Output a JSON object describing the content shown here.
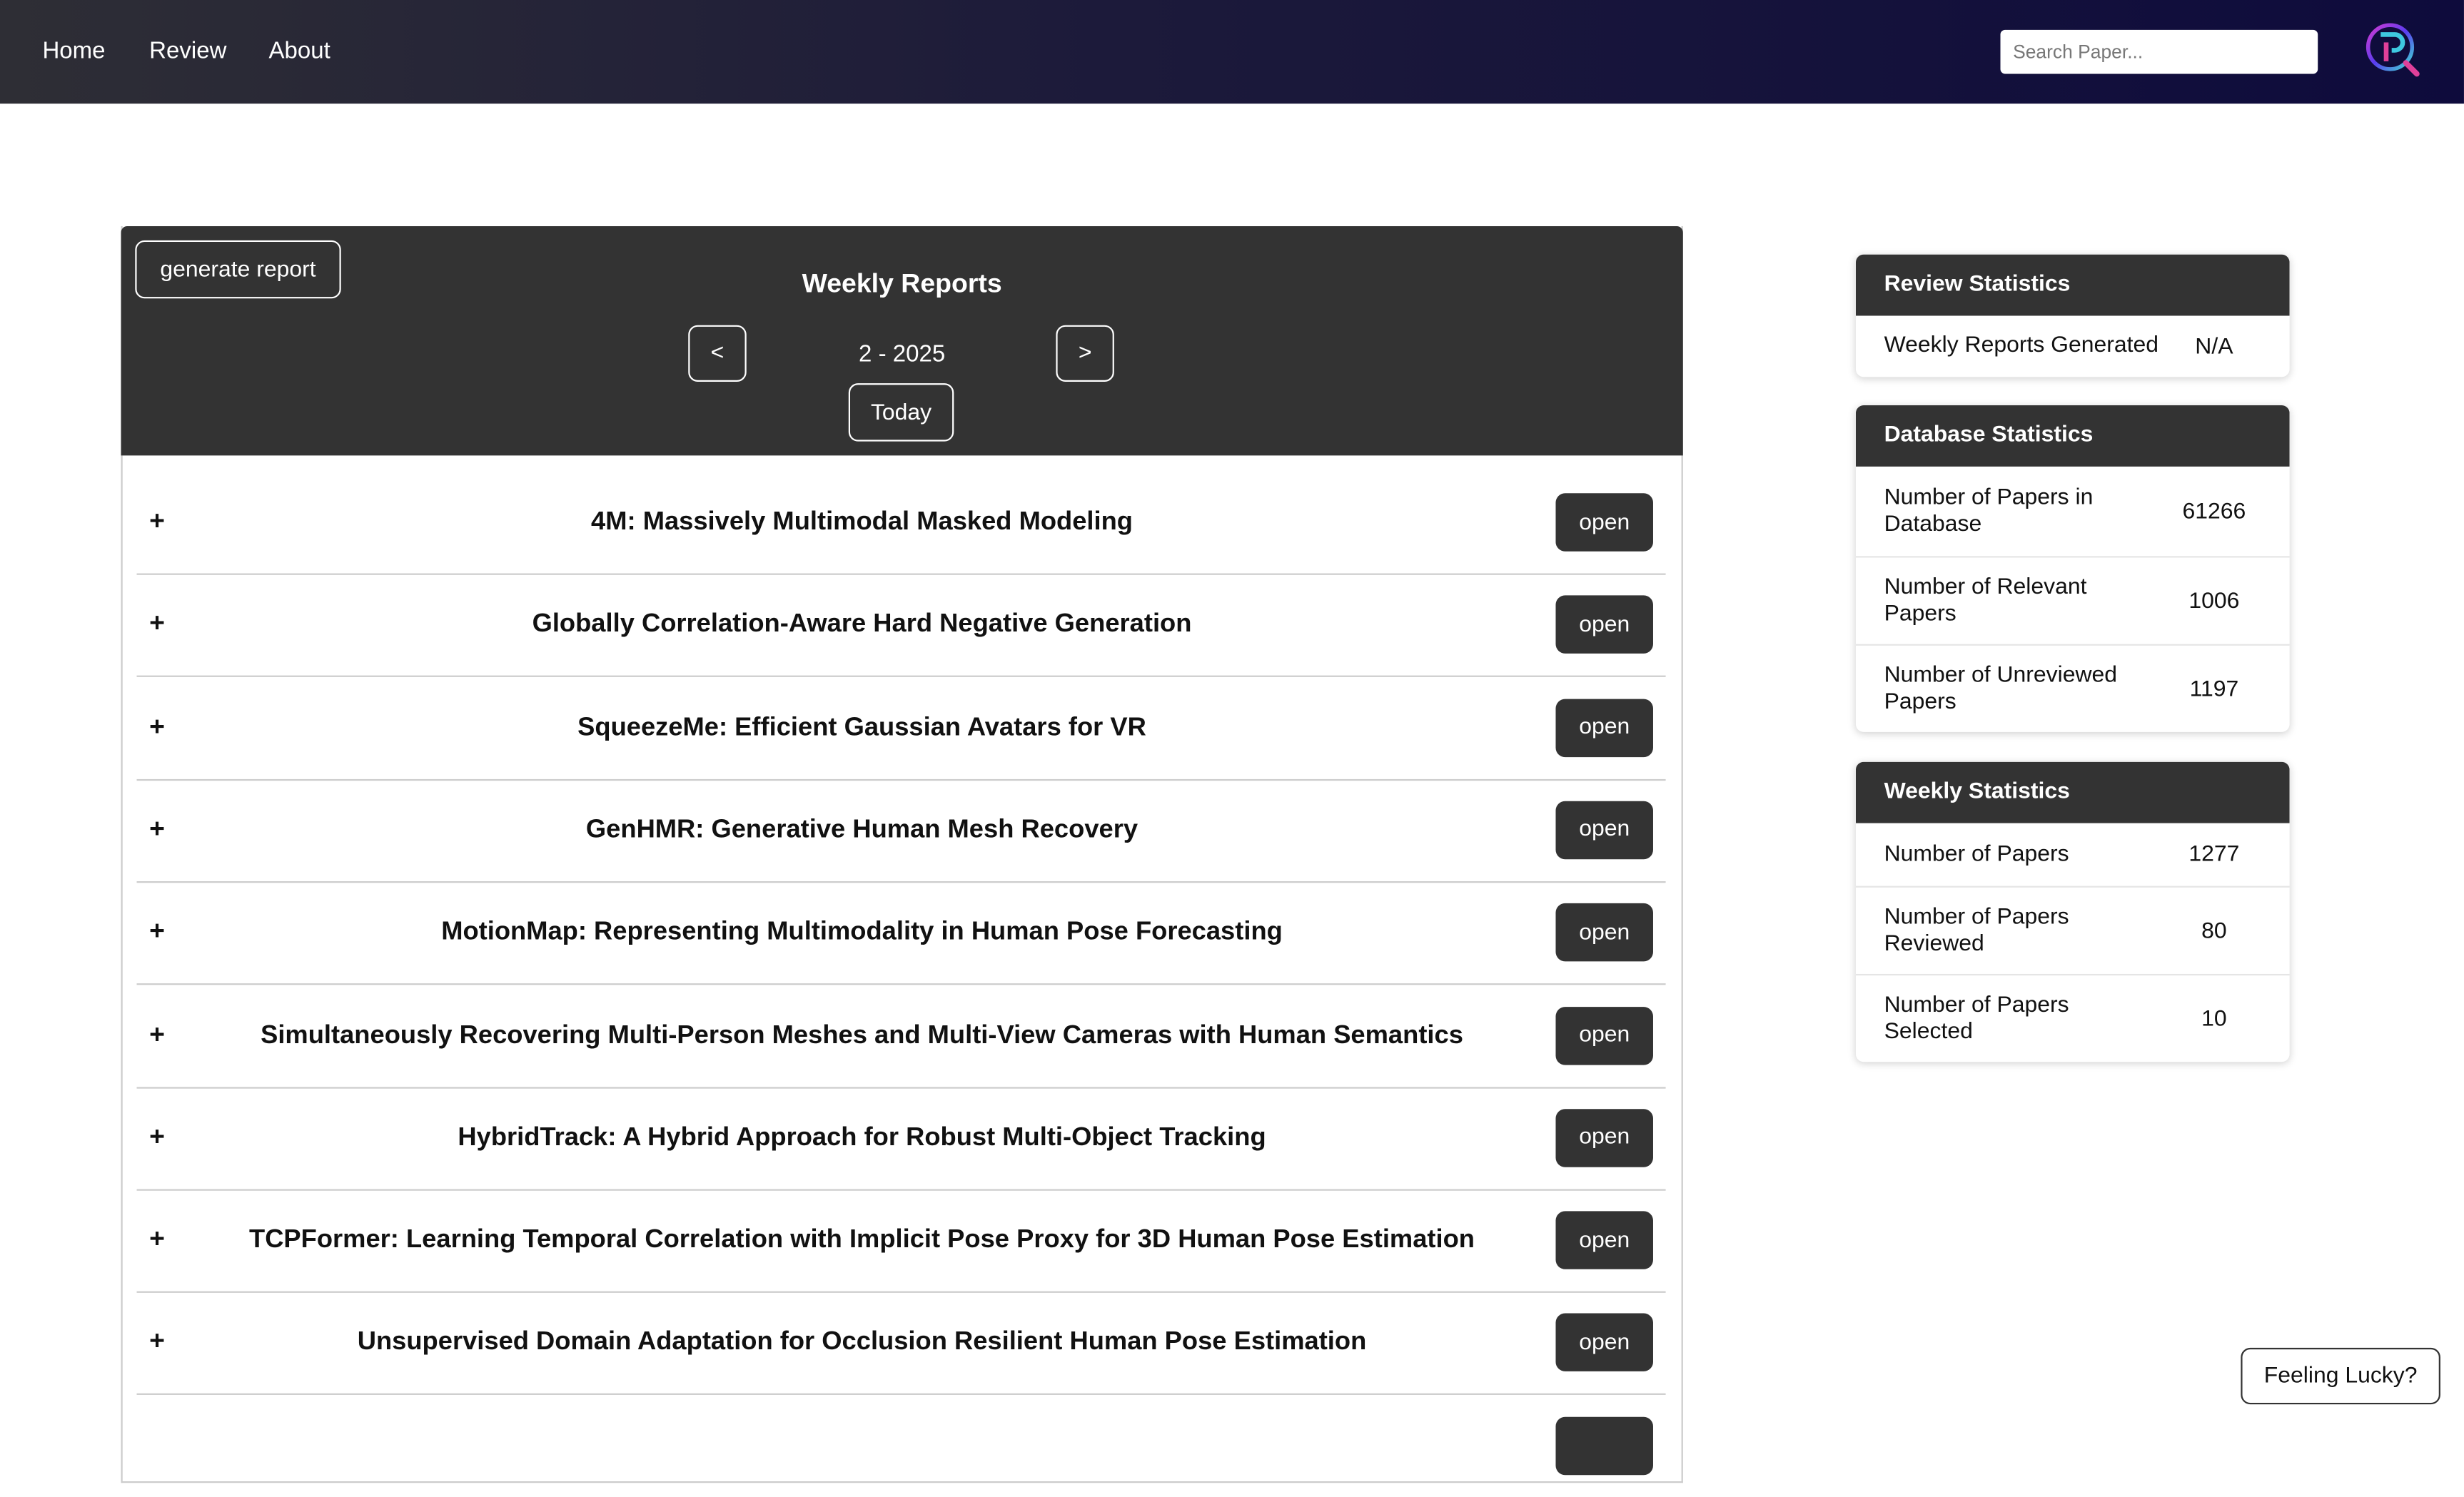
{
  "nav": {
    "home": "Home",
    "review": "Review",
    "about": "About",
    "search_placeholder": "Search Paper..."
  },
  "reports": {
    "generate": "generate report",
    "title": "Weekly Reports",
    "prev": "<",
    "next": ">",
    "week": "2 - 2025",
    "today": "Today"
  },
  "papers": [
    {
      "title": "4M: Massively Multimodal Masked Modeling",
      "open": "open"
    },
    {
      "title": "Globally Correlation-Aware Hard Negative Generation",
      "open": "open"
    },
    {
      "title": "SqueezeMe: Efficient Gaussian Avatars for VR",
      "open": "open"
    },
    {
      "title": "GenHMR: Generative Human Mesh Recovery",
      "open": "open"
    },
    {
      "title": "MotionMap: Representing Multimodality in Human Pose Forecasting",
      "open": "open"
    },
    {
      "title": "Simultaneously Recovering Multi-Person Meshes and Multi-View Cameras with Human Semantics",
      "open": "open"
    },
    {
      "title": "HybridTrack: A Hybrid Approach for Robust Multi-Object Tracking",
      "open": "open"
    },
    {
      "title": "TCPFormer: Learning Temporal Correlation with Implicit Pose Proxy for 3D Human Pose Estimation",
      "open": "open"
    },
    {
      "title": "Unsupervised Domain Adaptation for Occlusion Resilient Human Pose Estimation",
      "open": "open"
    }
  ],
  "review_stats": {
    "title": "Review Statistics",
    "rows": [
      {
        "label": "Weekly Reports Generated",
        "value": "N/A"
      }
    ]
  },
  "db_stats": {
    "title": "Database Statistics",
    "rows": [
      {
        "label": "Number of Papers in Database",
        "value": "61266"
      },
      {
        "label": "Number of Relevant Papers",
        "value": "1006"
      },
      {
        "label": "Number of Unreviewed Papers",
        "value": "1197"
      }
    ]
  },
  "weekly_stats": {
    "title": "Weekly Statistics",
    "rows": [
      {
        "label": "Number of Papers",
        "value": "1277"
      },
      {
        "label": "Number of Papers Reviewed",
        "value": "80"
      },
      {
        "label": "Number of Papers Selected",
        "value": "10"
      }
    ]
  },
  "lucky": "Feeling Lucky?"
}
